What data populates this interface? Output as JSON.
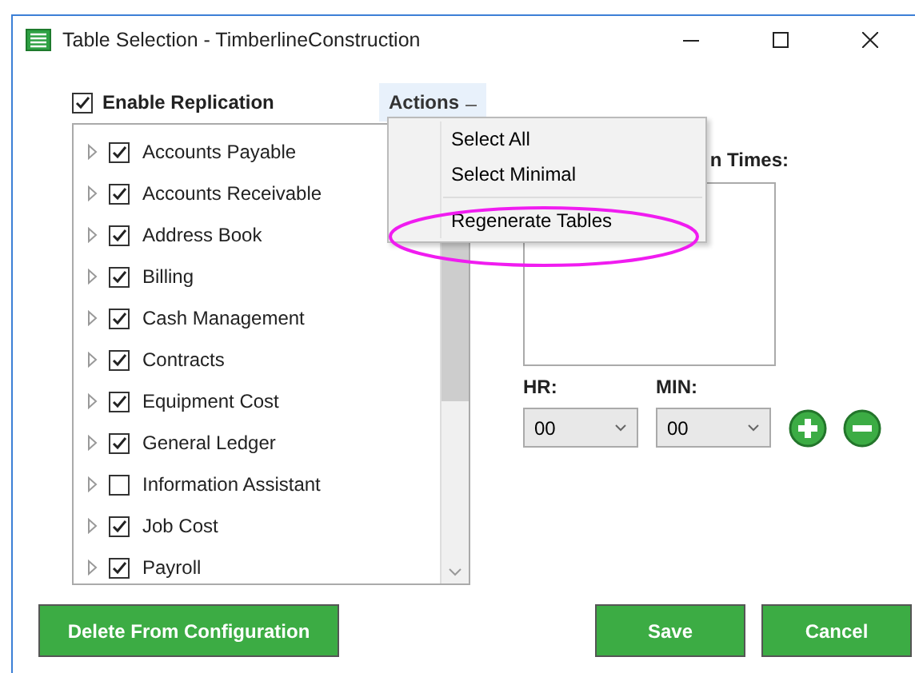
{
  "window": {
    "title": "Table Selection - TimberlineConstruction"
  },
  "enable_replication": {
    "label": "Enable Replication",
    "checked": true
  },
  "actions": {
    "label": "Actions",
    "expanded": true,
    "items": [
      {
        "kind": "item",
        "label": "Select All"
      },
      {
        "kind": "item",
        "label": "Select Minimal"
      },
      {
        "kind": "separator"
      },
      {
        "kind": "item",
        "label": "Regenerate Tables"
      }
    ]
  },
  "modules": [
    {
      "label": "Accounts Payable",
      "checked": true,
      "expanded": false
    },
    {
      "label": "Accounts Receivable",
      "checked": true,
      "expanded": false
    },
    {
      "label": "Address Book",
      "checked": true,
      "expanded": false
    },
    {
      "label": "Billing",
      "checked": true,
      "expanded": false
    },
    {
      "label": "Cash Management",
      "checked": true,
      "expanded": false
    },
    {
      "label": "Contracts",
      "checked": true,
      "expanded": false
    },
    {
      "label": "Equipment Cost",
      "checked": true,
      "expanded": false
    },
    {
      "label": "General Ledger",
      "checked": true,
      "expanded": false
    },
    {
      "label": "Information Assistant",
      "checked": false,
      "expanded": false
    },
    {
      "label": "Job Cost",
      "checked": true,
      "expanded": false
    },
    {
      "label": "Payroll",
      "checked": true,
      "expanded": false
    }
  ],
  "schedule": {
    "label": "n Times:",
    "hour": {
      "label": "HR:",
      "value": "00"
    },
    "minute": {
      "label": "MIN:",
      "value": "00"
    }
  },
  "buttons": [
    {
      "kind": "delete",
      "label": "Delete From Configuration"
    },
    {
      "kind": "save",
      "label": "Save"
    },
    {
      "kind": "cancel",
      "label": "Cancel"
    }
  ]
}
